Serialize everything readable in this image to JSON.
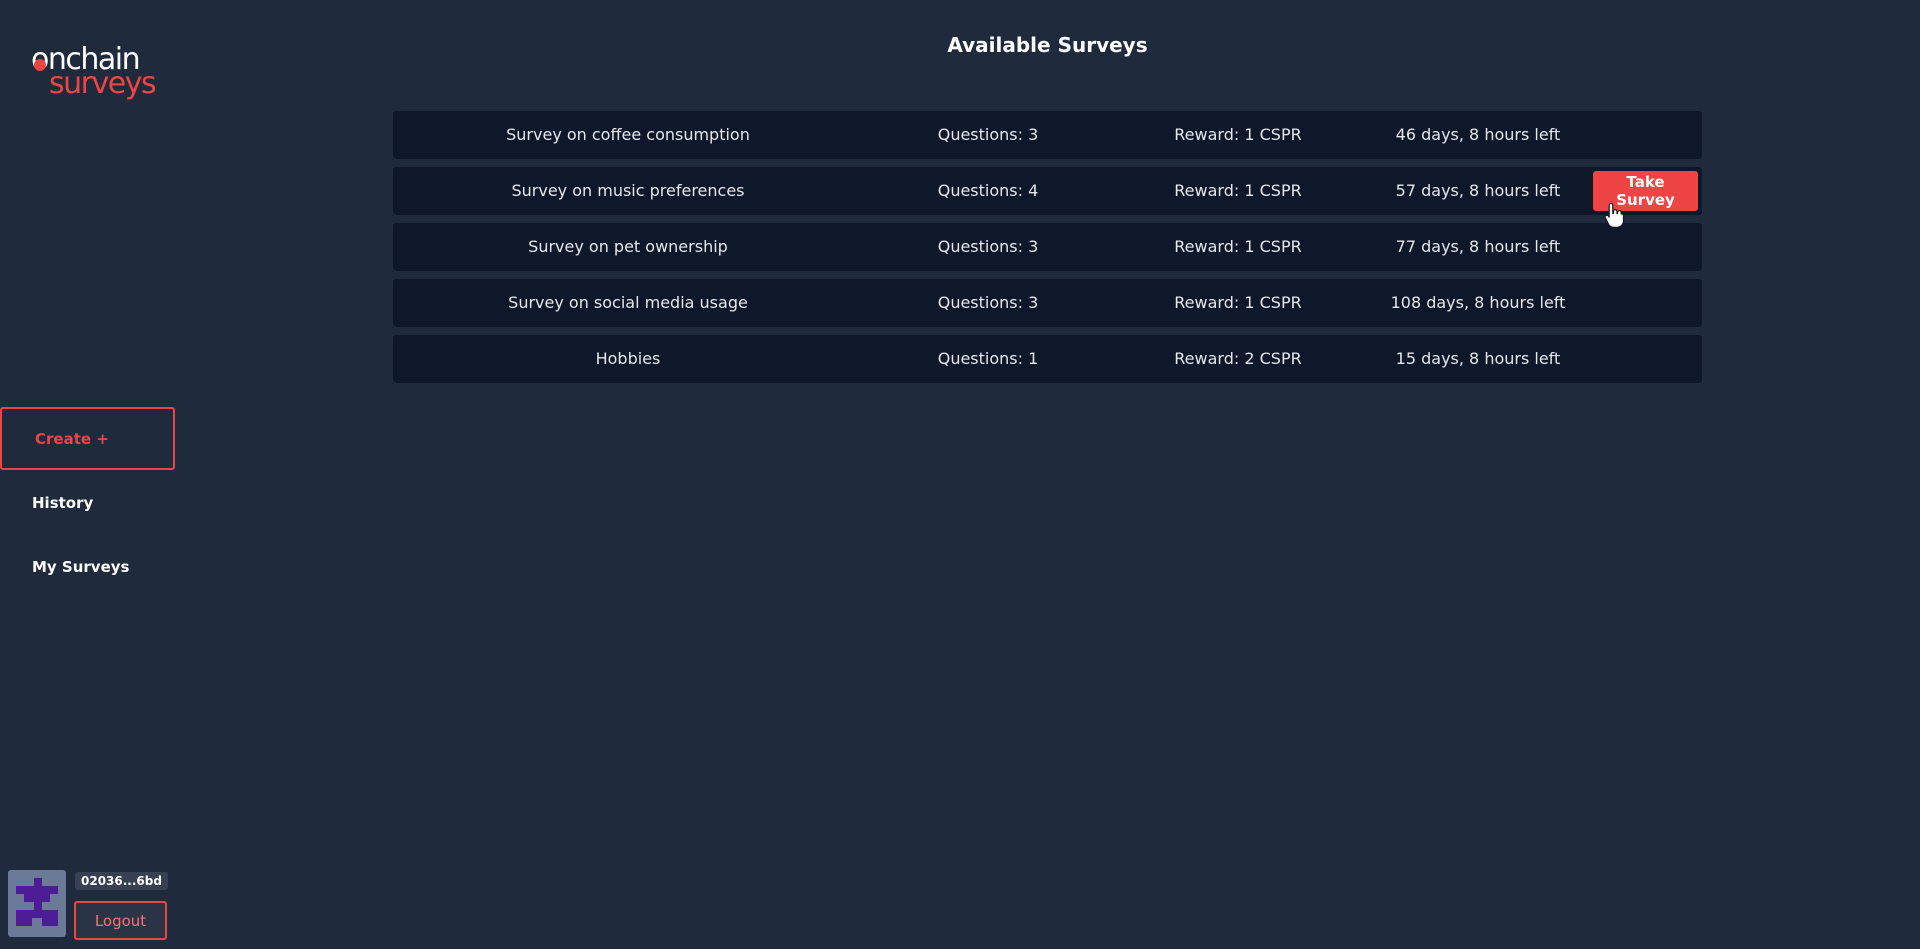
{
  "brand": {
    "top": "onchain",
    "bottom": "surveys"
  },
  "sidebar": {
    "create_label": "Create +",
    "nav": [
      {
        "label": "History"
      },
      {
        "label": "My Surveys"
      }
    ]
  },
  "user": {
    "address": "02036...6bd",
    "logout_label": "Logout",
    "avatar_icon": "identicon"
  },
  "main": {
    "title": "Available Surveys",
    "take_label": "Take Survey",
    "surveys": [
      {
        "title": "Survey on coffee consumption",
        "questions": "Questions: 3",
        "reward": "Reward: 1 CSPR",
        "time_left": "46 days, 8 hours left"
      },
      {
        "title": "Survey on music preferences",
        "questions": "Questions: 4",
        "reward": "Reward: 1 CSPR",
        "time_left": "57 days, 8 hours left"
      },
      {
        "title": "Survey on pet ownership",
        "questions": "Questions: 3",
        "reward": "Reward: 1 CSPR",
        "time_left": "77 days, 8 hours left"
      },
      {
        "title": "Survey on social media usage",
        "questions": "Questions: 3",
        "reward": "Reward: 1 CSPR",
        "time_left": "108 days, 8 hours left"
      },
      {
        "title": "Hobbies",
        "questions": "Questions: 1",
        "reward": "Reward: 2 CSPR",
        "time_left": "15 days, 8 hours left"
      }
    ]
  },
  "colors": {
    "background": "#1f2a3d",
    "row": "#0f172a",
    "accent": "#ef4444"
  }
}
